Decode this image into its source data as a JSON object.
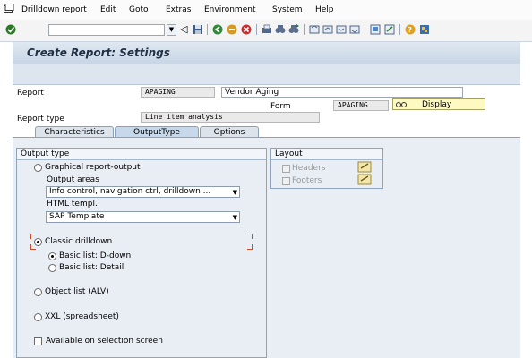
{
  "menubar": {
    "items": [
      "Drilldown report",
      "Edit",
      "Goto",
      "Extras",
      "Environment",
      "System",
      "Help"
    ]
  },
  "toolbar": {
    "command_field_value": ""
  },
  "page": {
    "title": "Create Report: Settings"
  },
  "header": {
    "report_label": "Report",
    "report_value": "APAGING",
    "report_description": "Vendor Aging",
    "form_label": "Form",
    "form_value": "APAGING",
    "display_button": "Display",
    "report_type_label": "Report type",
    "report_type_value": "Line item analysis"
  },
  "tabs": [
    {
      "label": "Characteristics",
      "active": false
    },
    {
      "label": "OutputType",
      "active": true
    },
    {
      "label": "Options",
      "active": false
    }
  ],
  "output_type": {
    "group_title": "Output type",
    "graphical": "Graphical report-output",
    "output_areas_label": "Output areas",
    "output_areas_value": "Info control, navigation ctrl, drilldown ...",
    "html_templ_label": "HTML templ.",
    "html_templ_value": "SAP Template",
    "classic_drilldown": "Classic drilldown",
    "basic_list_ddown": "Basic list: D-down",
    "basic_list_detail": "Basic list: Detail",
    "object_list": "Object list (ALV)",
    "xxl": "XXL (spreadsheet)",
    "available_selection": "Available on selection screen"
  },
  "layout": {
    "group_title": "Layout",
    "headers": "Headers",
    "footers": "Footers"
  }
}
